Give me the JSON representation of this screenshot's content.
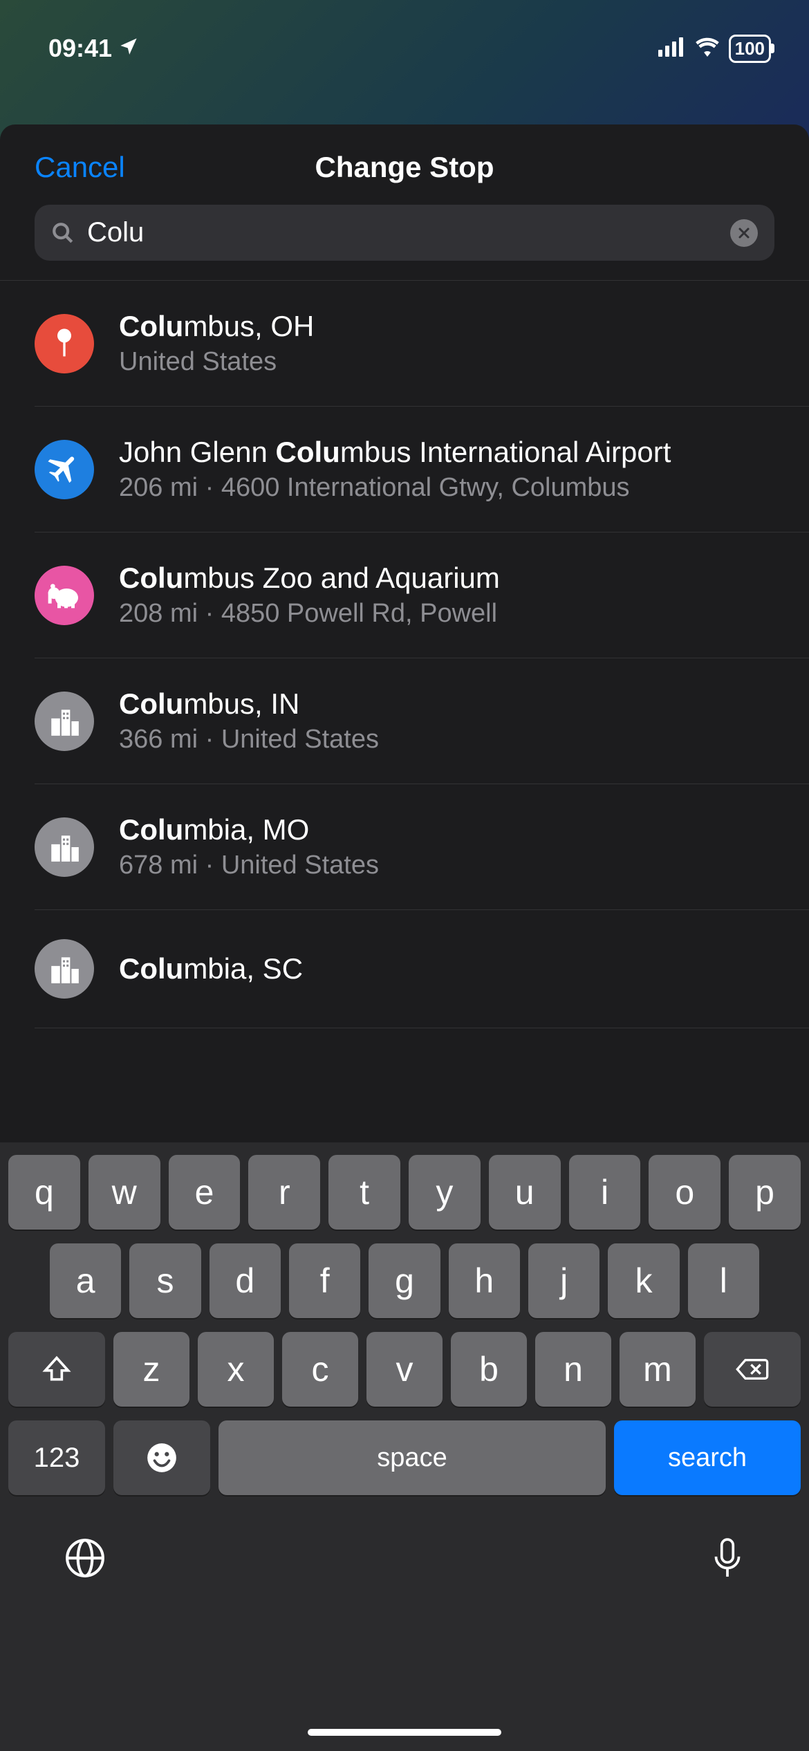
{
  "status": {
    "time": "09:41",
    "battery": "100"
  },
  "sheet": {
    "cancel": "Cancel",
    "title": "Change Stop"
  },
  "search": {
    "value": "Colu",
    "placeholder": "Search"
  },
  "icon_colors": {
    "pin": "#e74c3c",
    "airport": "#1e7fe0",
    "zoo": "#e855a4",
    "city": "#8e8e93"
  },
  "results": [
    {
      "icon": "pin",
      "title_match": "Colu",
      "title_rest": "mbus, OH",
      "subtitle": "United States"
    },
    {
      "icon": "airport",
      "title_pre": "John Glenn ",
      "title_match": "Colu",
      "title_rest": "mbus International Airport",
      "subtitle": "206 mi · 4600 International Gtwy, Columbus"
    },
    {
      "icon": "zoo",
      "title_match": "Colu",
      "title_rest": "mbus Zoo and Aquarium",
      "subtitle": "208 mi · 4850 Powell Rd, Powell"
    },
    {
      "icon": "city",
      "title_match": "Colu",
      "title_rest": "mbus, IN",
      "subtitle": "366 mi · United States"
    },
    {
      "icon": "city",
      "title_match": "Colu",
      "title_rest": "mbia, MO",
      "subtitle": "678 mi · United States"
    },
    {
      "icon": "city",
      "title_match": "Colu",
      "title_rest": "mbia, SC",
      "subtitle": ""
    }
  ],
  "keyboard": {
    "row1": [
      "q",
      "w",
      "e",
      "r",
      "t",
      "y",
      "u",
      "i",
      "o",
      "p"
    ],
    "row2": [
      "a",
      "s",
      "d",
      "f",
      "g",
      "h",
      "j",
      "k",
      "l"
    ],
    "row3": [
      "z",
      "x",
      "c",
      "v",
      "b",
      "n",
      "m"
    ],
    "numbers": "123",
    "space": "space",
    "search": "search"
  }
}
